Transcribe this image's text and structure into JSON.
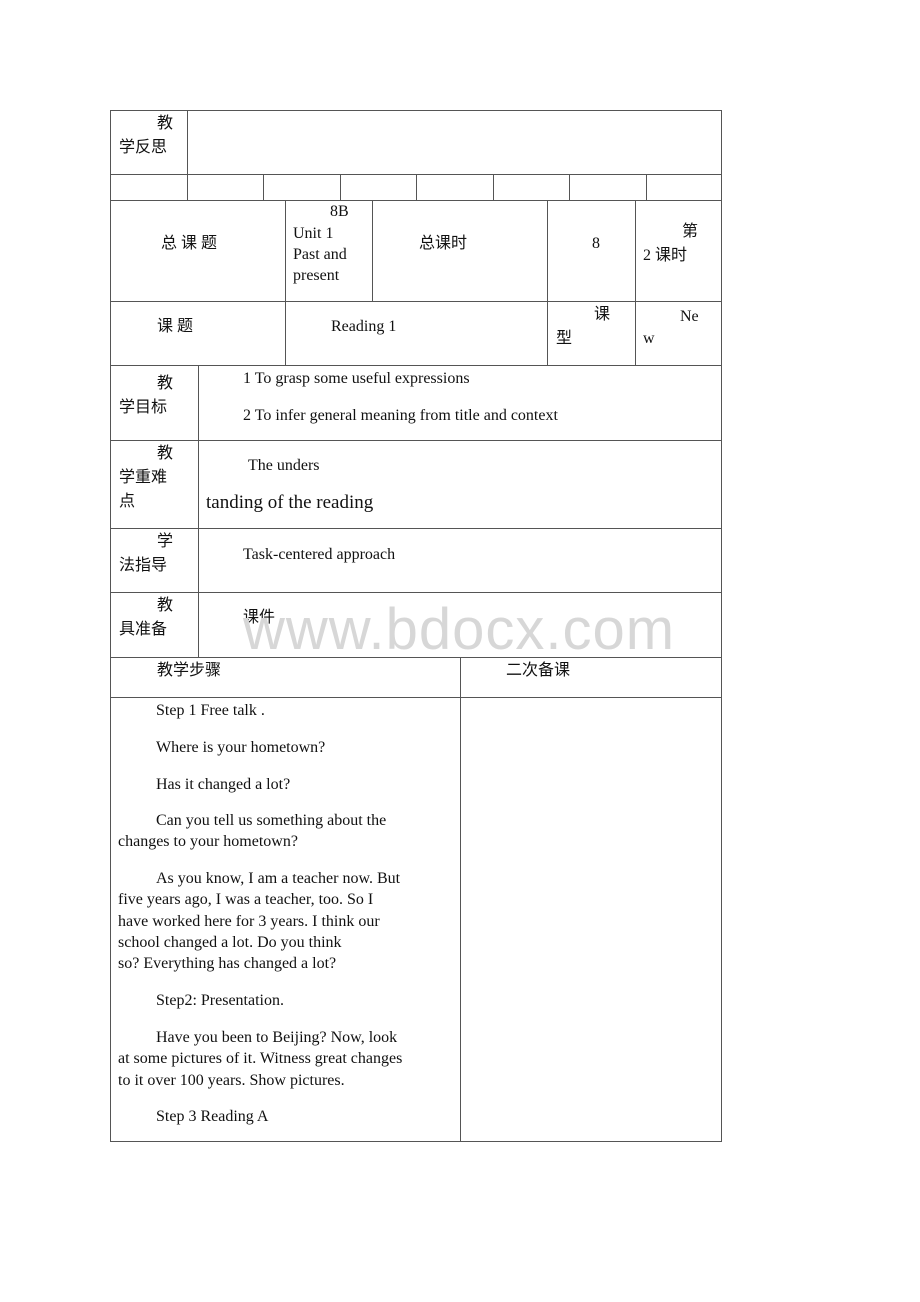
{
  "watermark": "www.bdocx.com",
  "reflection": {
    "label_line1": "教",
    "label_line2": "学反思",
    "content": ""
  },
  "total_topic": {
    "label": "总 课 题",
    "value_lines": [
      "8B",
      "Unit 1",
      "Past and",
      "present"
    ],
    "total_hours_label": "总课时",
    "total_hours_value": "8",
    "period_line1": "第",
    "period_line2": "2 课时"
  },
  "topic": {
    "label": "课 题",
    "value": "Reading 1",
    "type_label_line1": "课",
    "type_label_line2": "型",
    "type_value_line1": "Ne",
    "type_value_line2": "w"
  },
  "objectives": {
    "label_line1": "教",
    "label_line2": "学目标",
    "items": [
      "1 To grasp some useful expressions",
      "2 To infer general meaning from title and context"
    ]
  },
  "key_points": {
    "label_line1": "教",
    "label_line2": "学重难",
    "label_line3": "点",
    "line1": "The unders",
    "line2": "tanding of the reading"
  },
  "method": {
    "label_line1": "学",
    "label_line2": "法指导",
    "value": "Task-centered approach"
  },
  "tools": {
    "label_line1": "教",
    "label_line2": "具准备",
    "value": "课件"
  },
  "steps_header": {
    "left": "教学步骤",
    "right": "二次备课"
  },
  "steps": [
    [
      "        Step 1 Free talk ."
    ],
    [
      "        Where is your hometown?"
    ],
    [
      "        Has it changed a lot?"
    ],
    [
      "        Can you tell us something about the",
      "changes to your hometown?"
    ],
    [
      "        As you know, I am a teacher now. But",
      "five years ago, I was a teacher, too. So I",
      "have worked here for 3 years. I think our",
      "school changed a lot. Do you think",
      "so? Everything has changed a lot?"
    ],
    [
      "        Step2: Presentation."
    ],
    [
      "        Have you been to Beijing? Now, look",
      "at some pictures of it. Witness great changes",
      "to it over 100 years. Show pictures."
    ],
    [
      "        Step 3 Reading A"
    ]
  ]
}
